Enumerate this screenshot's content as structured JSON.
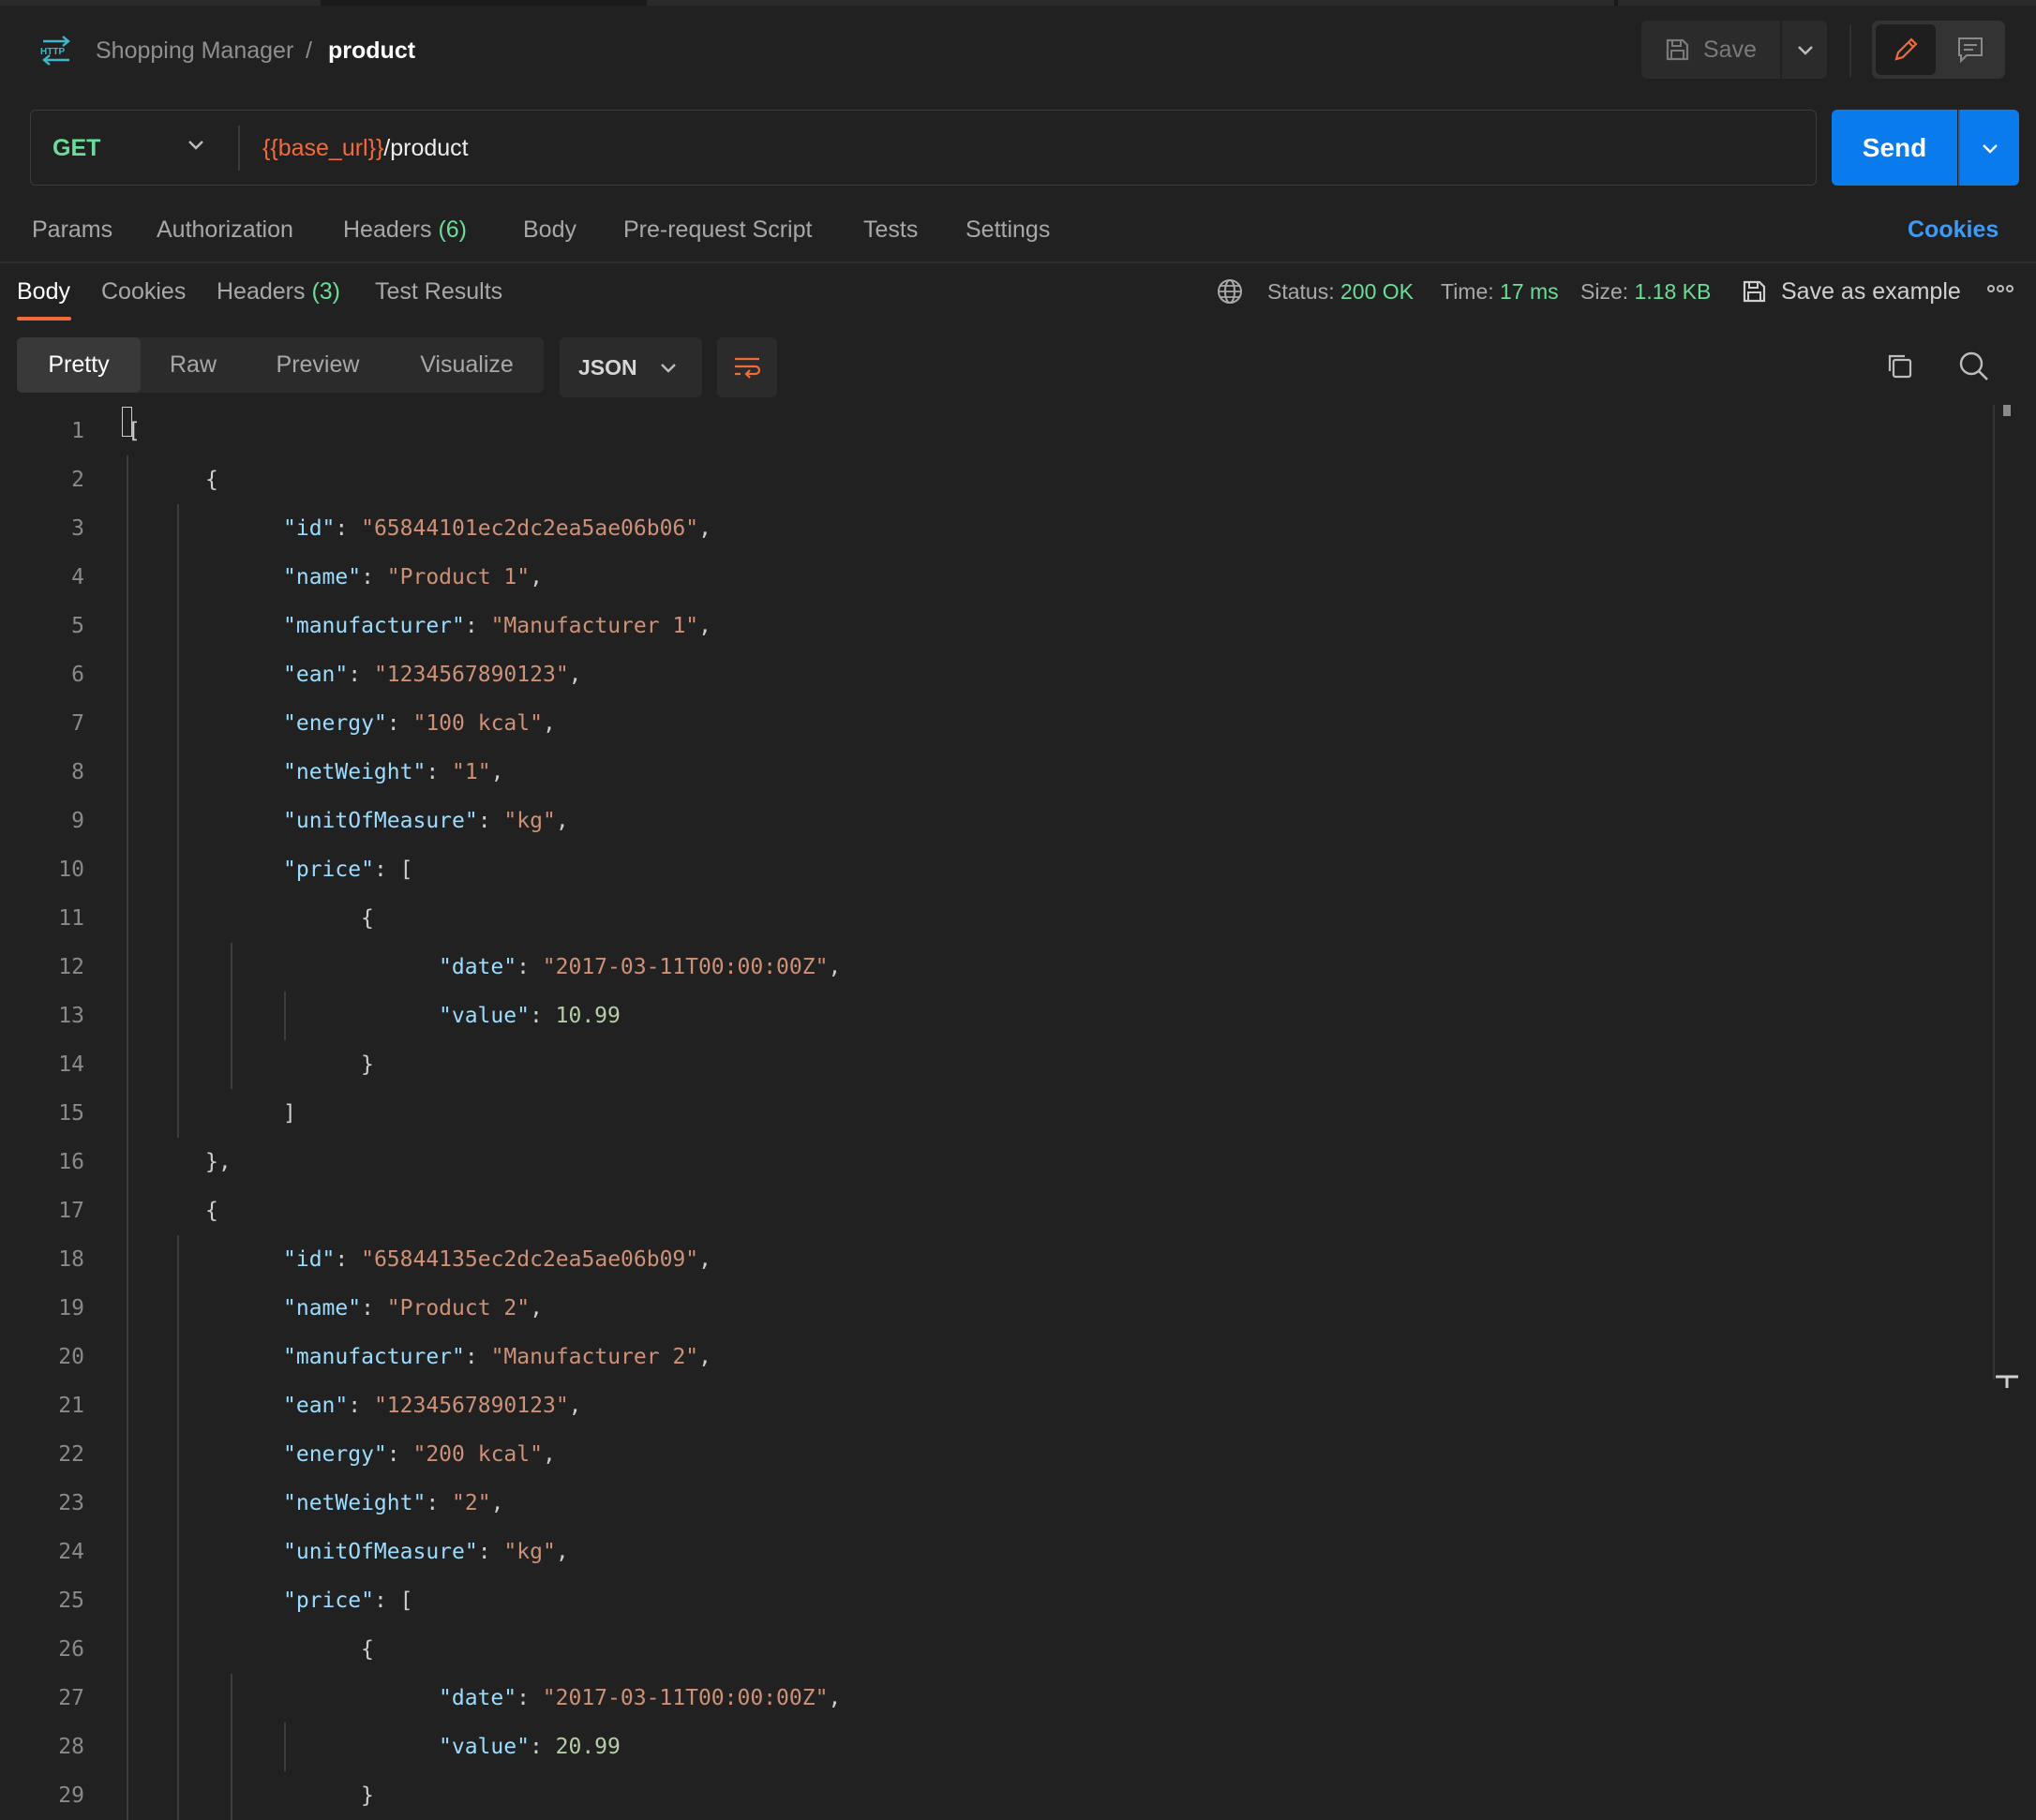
{
  "colors": {
    "background": "#212121",
    "accent": "#f26b3a",
    "send_button": "#097bed",
    "success": "#6bdd9a",
    "link": "#3d9af5"
  },
  "header": {
    "icon": "http-icon",
    "collection": "Shopping Manager",
    "separator": "/",
    "request_name": "product",
    "save_label": "Save"
  },
  "request": {
    "method": "GET",
    "url_variable": "{{base_url}}",
    "url_path": "/product",
    "send_label": "Send"
  },
  "request_tabs": {
    "params": "Params",
    "authorization": "Authorization",
    "headers": "Headers",
    "headers_count": "(6)",
    "body": "Body",
    "pre_request": "Pre-request Script",
    "tests": "Tests",
    "settings": "Settings",
    "cookies": "Cookies"
  },
  "response_tabs": {
    "body": "Body",
    "cookies": "Cookies",
    "headers": "Headers",
    "headers_count": "(3)",
    "test_results": "Test Results"
  },
  "response_meta": {
    "status_label": "Status:",
    "status_value": "200 OK",
    "time_label": "Time:",
    "time_value": "17 ms",
    "size_label": "Size:",
    "size_value": "1.18 KB",
    "save_example": "Save as example"
  },
  "view": {
    "modes": [
      "Pretty",
      "Raw",
      "Preview",
      "Visualize"
    ],
    "active_mode": "Pretty",
    "format": "JSON"
  },
  "code_lines": [
    [
      {
        "t": "[",
        "c": "p"
      }
    ],
    [
      {
        "t": "{",
        "c": "p"
      }
    ],
    [
      {
        "t": "\"id\"",
        "c": "k"
      },
      {
        "t": ": ",
        "c": "p"
      },
      {
        "t": "\"65844101ec2dc2ea5ae06b06\"",
        "c": "s"
      },
      {
        "t": ",",
        "c": "p"
      }
    ],
    [
      {
        "t": "\"name\"",
        "c": "k"
      },
      {
        "t": ": ",
        "c": "p"
      },
      {
        "t": "\"Product 1\"",
        "c": "s"
      },
      {
        "t": ",",
        "c": "p"
      }
    ],
    [
      {
        "t": "\"manufacturer\"",
        "c": "k"
      },
      {
        "t": ": ",
        "c": "p"
      },
      {
        "t": "\"Manufacturer 1\"",
        "c": "s"
      },
      {
        "t": ",",
        "c": "p"
      }
    ],
    [
      {
        "t": "\"ean\"",
        "c": "k"
      },
      {
        "t": ": ",
        "c": "p"
      },
      {
        "t": "\"1234567890123\"",
        "c": "s"
      },
      {
        "t": ",",
        "c": "p"
      }
    ],
    [
      {
        "t": "\"energy\"",
        "c": "k"
      },
      {
        "t": ": ",
        "c": "p"
      },
      {
        "t": "\"100 kcal\"",
        "c": "s"
      },
      {
        "t": ",",
        "c": "p"
      }
    ],
    [
      {
        "t": "\"netWeight\"",
        "c": "k"
      },
      {
        "t": ": ",
        "c": "p"
      },
      {
        "t": "\"1\"",
        "c": "s"
      },
      {
        "t": ",",
        "c": "p"
      }
    ],
    [
      {
        "t": "\"unitOfMeasure\"",
        "c": "k"
      },
      {
        "t": ": ",
        "c": "p"
      },
      {
        "t": "\"kg\"",
        "c": "s"
      },
      {
        "t": ",",
        "c": "p"
      }
    ],
    [
      {
        "t": "\"price\"",
        "c": "k"
      },
      {
        "t": ": [",
        "c": "p"
      }
    ],
    [
      {
        "t": "{",
        "c": "p"
      }
    ],
    [
      {
        "t": "\"date\"",
        "c": "k"
      },
      {
        "t": ": ",
        "c": "p"
      },
      {
        "t": "\"2017-03-11T00:00:00Z\"",
        "c": "s"
      },
      {
        "t": ",",
        "c": "p"
      }
    ],
    [
      {
        "t": "\"value\"",
        "c": "k"
      },
      {
        "t": ": ",
        "c": "p"
      },
      {
        "t": "10.99",
        "c": "n"
      }
    ],
    [
      {
        "t": "}",
        "c": "p"
      }
    ],
    [
      {
        "t": "]",
        "c": "p"
      }
    ],
    [
      {
        "t": "},",
        "c": "p"
      }
    ],
    [
      {
        "t": "{",
        "c": "p"
      }
    ],
    [
      {
        "t": "\"id\"",
        "c": "k"
      },
      {
        "t": ": ",
        "c": "p"
      },
      {
        "t": "\"65844135ec2dc2ea5ae06b09\"",
        "c": "s"
      },
      {
        "t": ",",
        "c": "p"
      }
    ],
    [
      {
        "t": "\"name\"",
        "c": "k"
      },
      {
        "t": ": ",
        "c": "p"
      },
      {
        "t": "\"Product 2\"",
        "c": "s"
      },
      {
        "t": ",",
        "c": "p"
      }
    ],
    [
      {
        "t": "\"manufacturer\"",
        "c": "k"
      },
      {
        "t": ": ",
        "c": "p"
      },
      {
        "t": "\"Manufacturer 2\"",
        "c": "s"
      },
      {
        "t": ",",
        "c": "p"
      }
    ],
    [
      {
        "t": "\"ean\"",
        "c": "k"
      },
      {
        "t": ": ",
        "c": "p"
      },
      {
        "t": "\"1234567890123\"",
        "c": "s"
      },
      {
        "t": ",",
        "c": "p"
      }
    ],
    [
      {
        "t": "\"energy\"",
        "c": "k"
      },
      {
        "t": ": ",
        "c": "p"
      },
      {
        "t": "\"200 kcal\"",
        "c": "s"
      },
      {
        "t": ",",
        "c": "p"
      }
    ],
    [
      {
        "t": "\"netWeight\"",
        "c": "k"
      },
      {
        "t": ": ",
        "c": "p"
      },
      {
        "t": "\"2\"",
        "c": "s"
      },
      {
        "t": ",",
        "c": "p"
      }
    ],
    [
      {
        "t": "\"unitOfMeasure\"",
        "c": "k"
      },
      {
        "t": ": ",
        "c": "p"
      },
      {
        "t": "\"kg\"",
        "c": "s"
      },
      {
        "t": ",",
        "c": "p"
      }
    ],
    [
      {
        "t": "\"price\"",
        "c": "k"
      },
      {
        "t": ": [",
        "c": "p"
      }
    ],
    [
      {
        "t": "{",
        "c": "p"
      }
    ],
    [
      {
        "t": "\"date\"",
        "c": "k"
      },
      {
        "t": ": ",
        "c": "p"
      },
      {
        "t": "\"2017-03-11T00:00:00Z\"",
        "c": "s"
      },
      {
        "t": ",",
        "c": "p"
      }
    ],
    [
      {
        "t": "\"value\"",
        "c": "k"
      },
      {
        "t": ": ",
        "c": "p"
      },
      {
        "t": "20.99",
        "c": "n"
      }
    ],
    [
      {
        "t": "}",
        "c": "p"
      }
    ]
  ]
}
